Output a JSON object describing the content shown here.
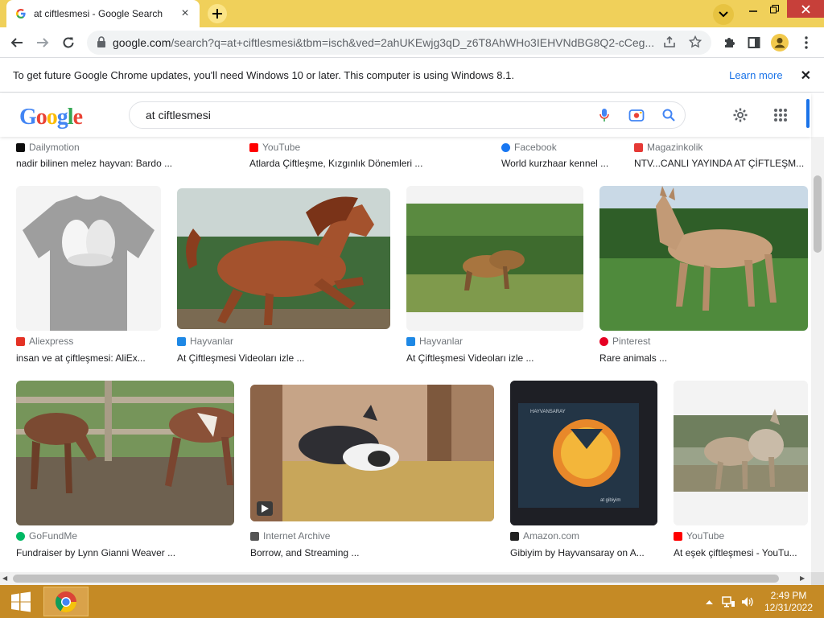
{
  "browser": {
    "tab_title": "at ciftlesmesi - Google Search",
    "url_host": "google.com",
    "url_rest": "/search?q=at+ciftlesmesi&tbm=isch&ved=2ahUKEwjg3qD_z6T8AhWHo3IEHVNdBG8Q2-cCeg..."
  },
  "infobar": {
    "message": "To get future Google Chrome updates, you'll need Windows 10 or later. This computer is using Windows 8.1.",
    "link": "Learn more"
  },
  "google": {
    "logo_text": "Google",
    "query": "at ciftlesmesi"
  },
  "results": {
    "row0": [
      {
        "source": "Dailymotion",
        "title": "nadir bilinen melez hayvan: Bardo ..."
      },
      {
        "source": "YouTube",
        "title": "Atlarda Çiftleşme, Kızgınlık Dönemleri ..."
      },
      {
        "source": "Facebook",
        "title": "World kurzhaar kennel ..."
      },
      {
        "source": "Magazinkolik",
        "title": "NTV...CANLI YAYINDA AT ÇİFTLEŞM..."
      }
    ],
    "row1": [
      {
        "source": "Aliexpress",
        "title": "insan ve at çiftleşmesi: AliEx..."
      },
      {
        "source": "Hayvanlar",
        "title": "At Çiftleşmesi Videoları izle ..."
      },
      {
        "source": "Hayvanlar",
        "title": "At Çiftleşmesi Videoları izle ..."
      },
      {
        "source": "Pinterest",
        "title": "Rare animals ..."
      }
    ],
    "row2": [
      {
        "source": "GoFundMe",
        "title": "Fundraiser by Lynn Gianni Weaver ..."
      },
      {
        "source": "Internet Archive",
        "title": "Borrow, and Streaming ..."
      },
      {
        "source": "Amazon.com",
        "title": "Gibiyim by Hayvansaray on A..."
      },
      {
        "source": "YouTube",
        "title": "At eşek çiftleşmesi - YouTu..."
      }
    ],
    "album_text_top": "HAYVANSARAY",
    "album_text_bottom": "at gibiyim"
  },
  "taskbar": {
    "time": "2:49 PM",
    "date": "12/31/2022"
  },
  "colors": {
    "titlebar": "#f0d05a",
    "taskbar": "#c58a25",
    "accent": "#1a73e8"
  }
}
